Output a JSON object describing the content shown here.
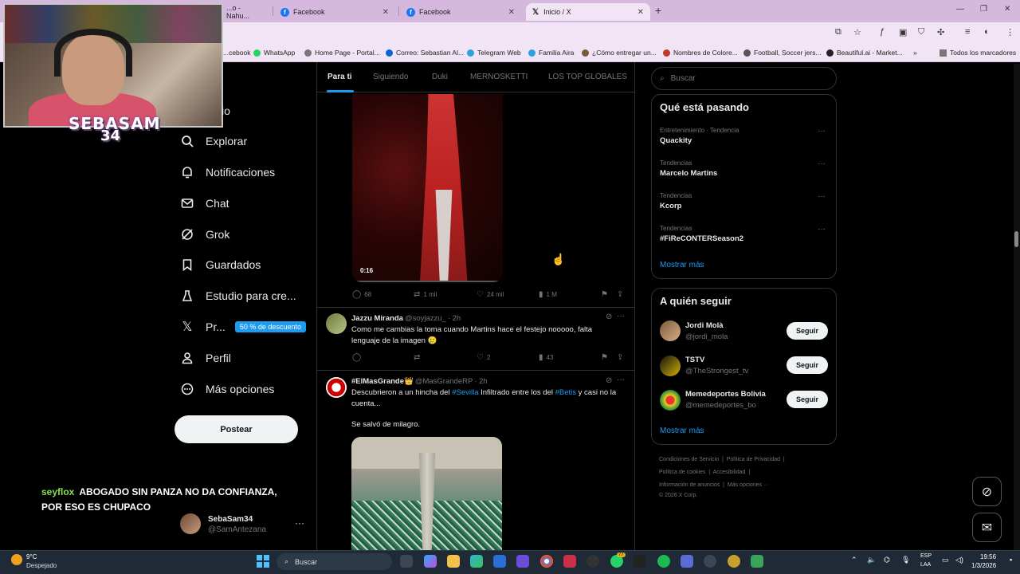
{
  "browser": {
    "tabs": [
      {
        "label": "...o - Nahu...",
        "icon": "tab-icon",
        "active": false
      },
      {
        "label": "Facebook",
        "icon": "facebook-icon",
        "active": false
      },
      {
        "label": "Facebook",
        "icon": "facebook-icon",
        "active": false
      },
      {
        "label": "Inicio / X",
        "icon": "x-logo-icon",
        "active": true
      }
    ],
    "bookmarks": [
      {
        "label": "...cebook",
        "color": "#1877f2"
      },
      {
        "label": "WhatsApp",
        "color": "#25d366"
      },
      {
        "label": "Home Page - Portal...",
        "color": "#777777"
      },
      {
        "label": "Correo: Sebastian Al...",
        "color": "#0a64d6"
      },
      {
        "label": "Telegram Web",
        "color": "#2aa3e0"
      },
      {
        "label": "Familia Aira",
        "color": "#2aa3e0"
      },
      {
        "label": "¿Cómo entregar un...",
        "color": "#7a5c3a"
      },
      {
        "label": "Nombres de Colore...",
        "color": "#c0392b"
      },
      {
        "label": "Football, Soccer jers...",
        "color": "#555555"
      },
      {
        "label": "Beautiful.ai - Market...",
        "color": "#222222"
      },
      {
        "label": "Todos los marcadores",
        "color": "#777777"
      }
    ]
  },
  "overlay": {
    "streamer_name": "SEBASAM",
    "streamer_num": "34",
    "chat_user": "seyflox",
    "chat_message": "ABOGADO SIN PANZA NO DA CONFIANZA, POR ESO ES CHUPACO"
  },
  "nav": {
    "partial_top": "io",
    "items": [
      {
        "label": "Explorar",
        "icon": "search-icon"
      },
      {
        "label": "Notificaciones",
        "icon": "bell-icon"
      },
      {
        "label": "Chat",
        "icon": "mail-icon"
      },
      {
        "label": "Grok",
        "icon": "grok-icon"
      },
      {
        "label": "Guardados",
        "icon": "bookmark-icon"
      },
      {
        "label": "Estudio para cre...",
        "icon": "creator-studio-icon"
      },
      {
        "label": "Pr...",
        "icon": "x-logo-icon",
        "badge": "50 % de descuento"
      },
      {
        "label": "Perfil",
        "icon": "person-icon"
      },
      {
        "label": "Más opciones",
        "icon": "more-circle-icon"
      }
    ],
    "post_button": "Postear",
    "account": {
      "name": "SebaSam34",
      "handle": "@SamAntezana"
    }
  },
  "timeline": {
    "tabs": [
      "Para ti",
      "Siguiendo",
      "Duki",
      "MERNOSKETTI",
      "LOS TOP GLOBALES"
    ],
    "active_tab": "Para ti",
    "post1": {
      "video_time": "0:16",
      "replies": "68",
      "reposts": "1 mil",
      "likes": "24 mil",
      "views": "1 M"
    },
    "post2": {
      "name": "Jazzu Miranda",
      "handle": "@soyjazzu_",
      "time": "· 2h",
      "text": "Como me cambias la toma cuando Martins hace el festejo nooooo, falta lenguaje de la imagen 🥲",
      "replies": "",
      "reposts": "",
      "likes": "2",
      "views": "43"
    },
    "post3": {
      "name": "#ElMasGrande👑",
      "handle": "@MasGrandeRP",
      "time": "· 2h",
      "text_a": "Descubrieron a un hincha del ",
      "link_a": "#Sevilla",
      "text_b": " Infiltrado entre los del ",
      "link_b": "#Betis",
      "text_c": " y casi no la cuenta...",
      "text2": "Se salvó de milagro."
    }
  },
  "sidebar": {
    "search_placeholder": "Buscar",
    "trends_title": "Qué está pasando",
    "trends": [
      {
        "meta": "Entretenimiento · Tendencia",
        "name": "Quackity"
      },
      {
        "meta": "Tendencias",
        "name": "Marcelo Martins"
      },
      {
        "meta": "Tendencias",
        "name": "Kcorp"
      },
      {
        "meta": "Tendencias",
        "name": "#FiReCONTERSeason2"
      }
    ],
    "trends_more": "Mostrar más",
    "follow_title": "A quién seguir",
    "follow": [
      {
        "name": "Jordi Molà",
        "handle": "@jordi_mola",
        "button": "Seguir"
      },
      {
        "name": "TSTV",
        "handle": "@TheStrongest_tv",
        "button": "Seguir"
      },
      {
        "name": "Memedeportes Bolivia",
        "handle": "@memedeportes_bo",
        "button": "Seguir"
      }
    ],
    "follow_more": "Mostrar más",
    "footer": {
      "line1a": "Condiciones de Servicio",
      "line1b": "Política de Privacidad",
      "line2a": "Política de cookies",
      "line2b": "Accesibilidad",
      "line3a": "Información de anuncios",
      "line3b": "Más opciones ···",
      "line4": "© 2026 X Corp."
    }
  },
  "taskbar": {
    "temp": "9°C",
    "weather": "Despejado",
    "search": "Buscar",
    "lang1": "ESP",
    "lang2": "LAA",
    "time": "19:56",
    "date": "1/3/2026",
    "badge_count": "77"
  }
}
